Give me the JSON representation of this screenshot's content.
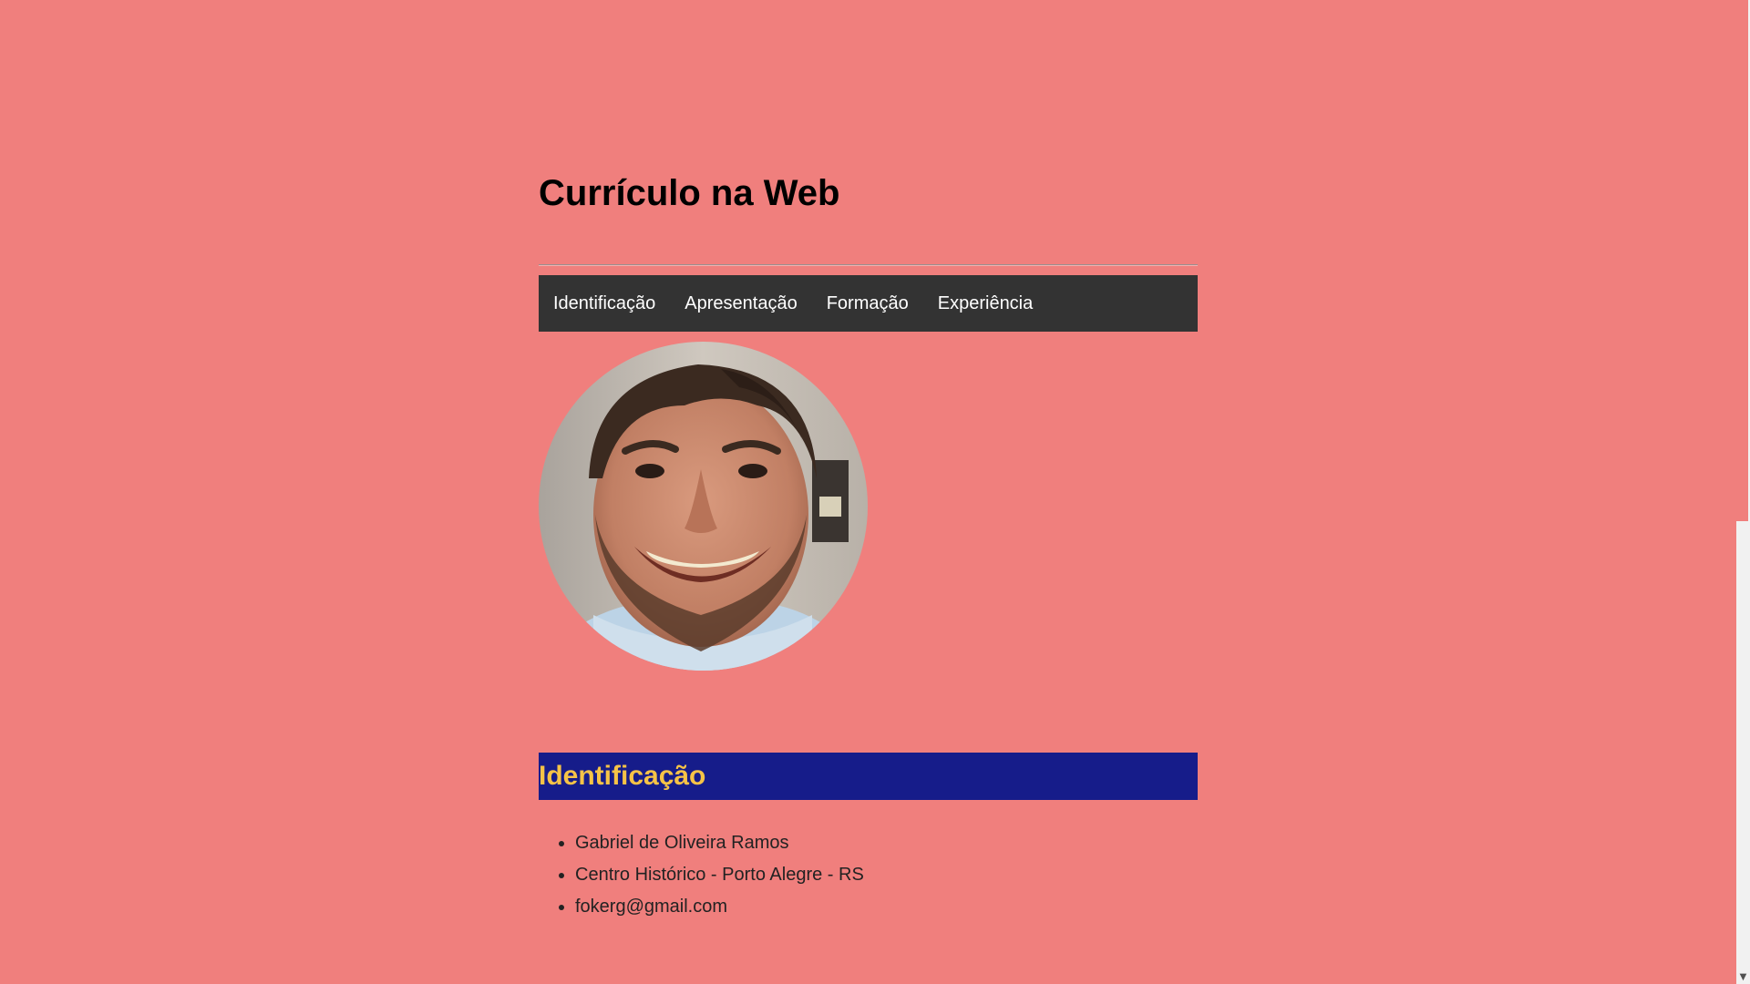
{
  "header": {
    "title": "Currículo na Web"
  },
  "nav": {
    "items": [
      {
        "label": "Identificação"
      },
      {
        "label": "Apresentação"
      },
      {
        "label": "Formação"
      },
      {
        "label": "Experiência"
      }
    ]
  },
  "profile": {
    "photo_icon": "profile-photo"
  },
  "identification": {
    "heading": "Identificação",
    "items": [
      "Gabriel de Oliveira Ramos",
      "Centro Histórico - Porto Alegre - RS",
      "fokerg@gmail.com"
    ]
  },
  "colors": {
    "page_background": "#f07f7d",
    "nav_background": "#333333",
    "section_header_background": "#161c8a",
    "section_header_text": "#f6c347"
  }
}
